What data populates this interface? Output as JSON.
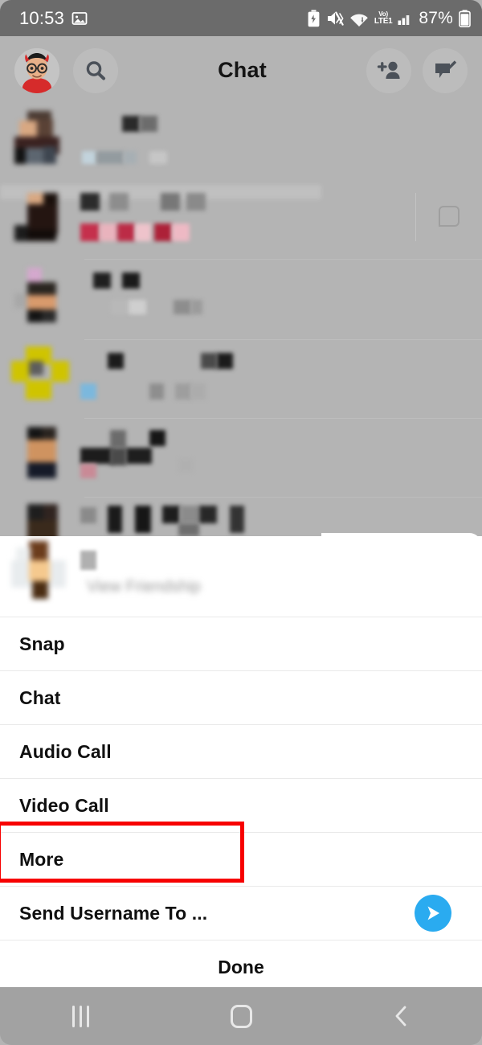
{
  "status_bar": {
    "time": "10:53",
    "screenshot_icon": "image-icon",
    "battery_saver_icon": "battery-saver-icon",
    "sound_icon": "mute-vibrate-icon",
    "wifi_icon": "wifi-icon",
    "volte_top": "Vo)",
    "volte_bottom": "LTE1",
    "signal_icon": "signal-bars-icon",
    "battery_percent": "87%",
    "battery_icon": "battery-icon"
  },
  "header": {
    "title": "Chat",
    "avatar": "bitmoji-avatar",
    "search_icon": "search-icon",
    "add_friend_icon": "add-friend-icon",
    "new_chat_icon": "new-chat-icon"
  },
  "chat_list": {
    "row_icon": "chat-bubble-icon",
    "rows": [
      {
        "name": "chat-row-1"
      },
      {
        "name": "chat-row-2"
      },
      {
        "name": "chat-row-3"
      },
      {
        "name": "chat-row-4"
      },
      {
        "name": "chat-row-5"
      },
      {
        "name": "chat-row-6"
      }
    ]
  },
  "sheet": {
    "friend_label": "View Friendship",
    "items": [
      {
        "label": "Snap",
        "name": "menu-item-snap"
      },
      {
        "label": "Chat",
        "name": "menu-item-chat"
      },
      {
        "label": "Audio Call",
        "name": "menu-item-audio-call"
      },
      {
        "label": "Video Call",
        "name": "menu-item-video-call"
      },
      {
        "label": "More",
        "name": "menu-item-more"
      },
      {
        "label": "Send Username To ...",
        "name": "menu-item-send-username"
      }
    ],
    "send_icon": "send-arrow-icon",
    "done_label": "Done"
  },
  "highlight": {
    "color": "#f70000",
    "target": "More"
  },
  "nav_bar": {
    "recents_icon": "recents-icon",
    "home_icon": "home-icon",
    "back_icon": "back-icon"
  },
  "colors": {
    "accent_blue": "#2aabf0",
    "highlight_red": "#f70000",
    "background_gray": "#b4b4b4",
    "status_bar_gray": "#6b6b6b",
    "nav_bar_gray": "#a2a2a2"
  }
}
